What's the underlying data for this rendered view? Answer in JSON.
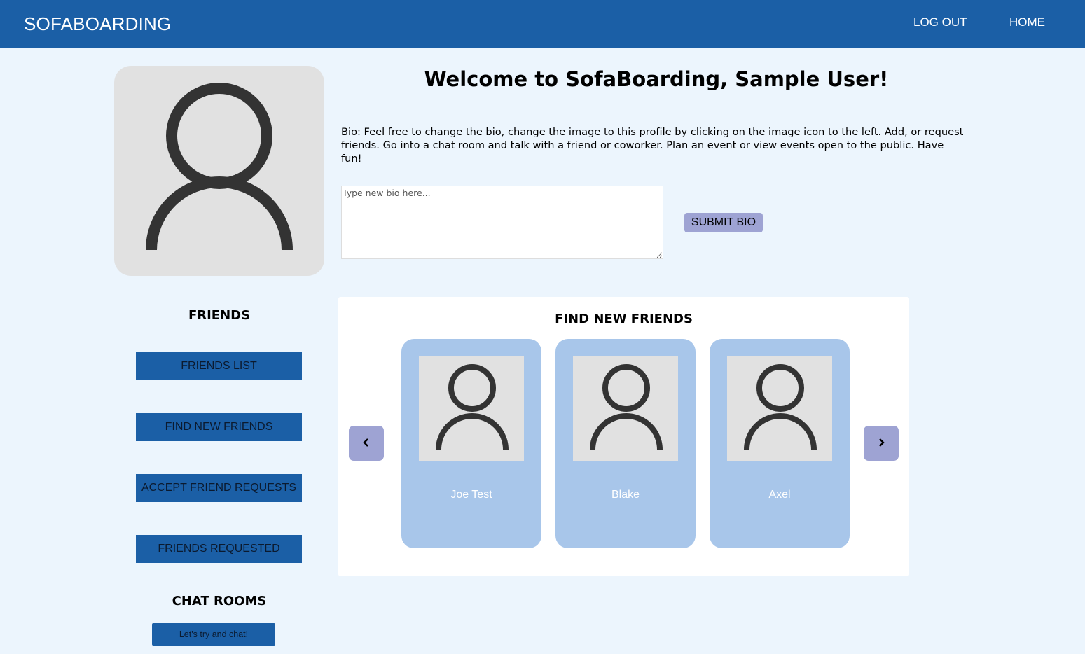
{
  "navbar": {
    "brand": "SOFABOARDING",
    "links": [
      "LOG OUT",
      "HOME"
    ]
  },
  "profile": {
    "avatar_icon": "user-silhouette-icon",
    "welcome": "Welcome to SofaBoarding, Sample User!",
    "bio": "Bio: Feel free to change the bio, change the image to this profile by clicking on the image icon to the left. Add, or request friends. Go into a chat room and talk with a friend or coworker. Plan an event or view events open to the public. Have fun!",
    "bio_input": {
      "value": "",
      "placeholder": "Type new bio here..."
    },
    "submit_label": "SUBMIT BIO"
  },
  "friends": {
    "heading": "FRIENDS",
    "buttons": [
      "FRIENDS LIST",
      "FIND NEW FRIENDS",
      "ACCEPT FRIEND REQUESTS",
      "FRIENDS REQUESTED"
    ]
  },
  "chat": {
    "heading": "CHAT ROOMS",
    "rooms": [
      "Let's try and chat!"
    ]
  },
  "find_new_friends": {
    "title": "FIND NEW FRIENDS",
    "prev_icon": "chevron-left-icon",
    "next_icon": "chevron-right-icon",
    "cards": [
      {
        "name": "Joe Test",
        "icon": "user-silhouette-icon"
      },
      {
        "name": "Blake",
        "icon": "user-silhouette-icon"
      },
      {
        "name": "Axel",
        "icon": "user-silhouette-icon"
      }
    ]
  },
  "colors": {
    "navbar": "#1b5fa6",
    "page_background": "#ecf5fd",
    "card": "#a8c6ea",
    "accent_button": "#9ea3d3"
  }
}
